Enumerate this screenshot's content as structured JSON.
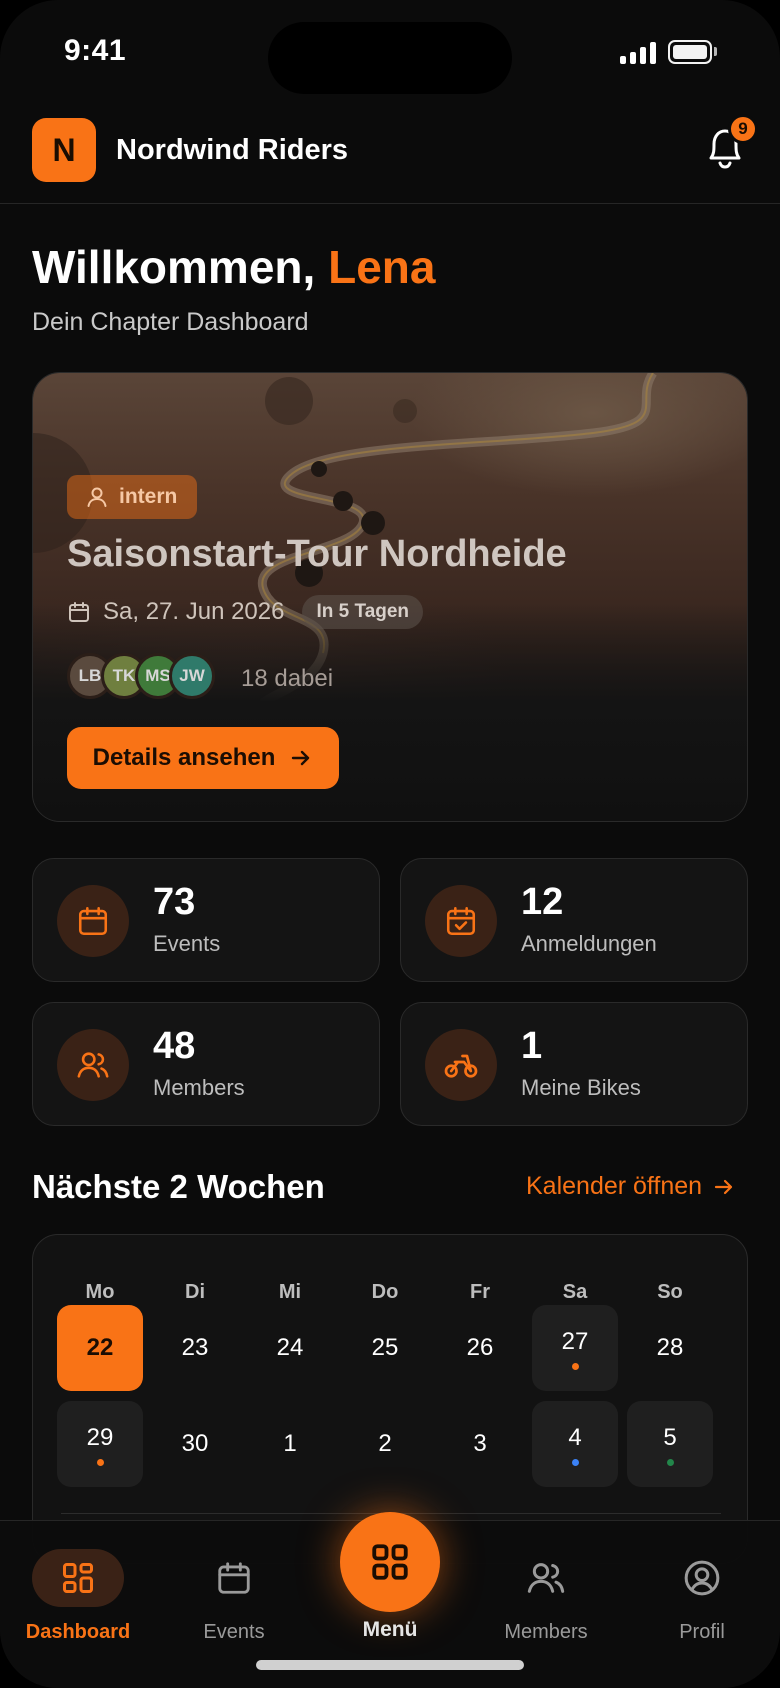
{
  "status": {
    "time": "9:41"
  },
  "header": {
    "logo_letter": "N",
    "title": "Nordwind Riders",
    "notification_count": "9"
  },
  "welcome": {
    "greeting": "Willkommen,",
    "name": "Lena",
    "subtitle": "Dein Chapter Dashboard"
  },
  "hero": {
    "tag": "intern",
    "title": "Saisonstart-Tour Nordheide",
    "date": "Sa, 27. Jun 2026",
    "countdown": "In 5 Tagen",
    "avatars": [
      {
        "initials": "LB",
        "color": "#5a4a3e"
      },
      {
        "initials": "TK",
        "color": "#6f7f3f"
      },
      {
        "initials": "MS",
        "color": "#3f7a3a"
      },
      {
        "initials": "JW",
        "color": "#2f7a6a"
      }
    ],
    "attendees": "18 dabei",
    "button": "Details ansehen"
  },
  "stats": [
    {
      "value": "73",
      "label": "Events",
      "icon": "calendar-icon"
    },
    {
      "value": "12",
      "label": "Anmeldungen",
      "icon": "calendar-check-icon"
    },
    {
      "value": "48",
      "label": "Members",
      "icon": "users-icon"
    },
    {
      "value": "1",
      "label": "Meine Bikes",
      "icon": "motorbike-icon"
    }
  ],
  "calendar_section": {
    "title": "Nächste 2 Wochen",
    "link": "Kalender öffnen"
  },
  "calendar": {
    "weekdays": [
      "Mo",
      "Di",
      "Mi",
      "Do",
      "Fr",
      "Sa",
      "So"
    ],
    "weeks": [
      [
        {
          "day": "22",
          "state": "today"
        },
        {
          "day": "23"
        },
        {
          "day": "24"
        },
        {
          "day": "25"
        },
        {
          "day": "26"
        },
        {
          "day": "27",
          "state": "event",
          "dot": "#f97316"
        },
        {
          "day": "28"
        }
      ],
      [
        {
          "day": "29",
          "state": "event",
          "dot": "#f97316"
        },
        {
          "day": "30"
        },
        {
          "day": "1"
        },
        {
          "day": "2"
        },
        {
          "day": "3"
        },
        {
          "day": "4",
          "state": "event",
          "dot": "#3b82f6"
        },
        {
          "day": "5",
          "state": "event",
          "dot": "#22864a"
        }
      ]
    ]
  },
  "nav": {
    "dashboard": "Dashboard",
    "events": "Events",
    "menu": "Menü",
    "members": "Members",
    "profile": "Profil"
  },
  "colors": {
    "accent": "#f97316",
    "background": "#0b0b0b",
    "card": "#141414"
  }
}
